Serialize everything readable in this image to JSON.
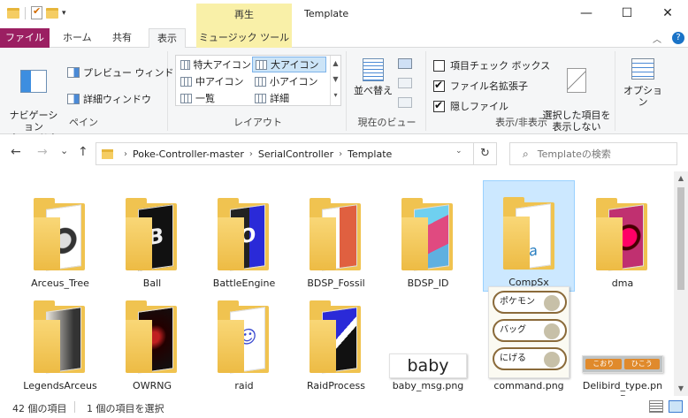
{
  "window": {
    "title": "Template",
    "context_tab_group": "再生",
    "controls": {
      "minimize": "—",
      "maximize": "☐",
      "close": "✕"
    }
  },
  "quick_access": {
    "dropdown": "▾"
  },
  "ribbon_tabs": {
    "file": "ファイル",
    "home": "ホーム",
    "share": "共有",
    "view": "表示",
    "music": "ミュージック ツール",
    "collapse": "︿",
    "help": "?"
  },
  "ribbon": {
    "panes": {
      "nav_pane": "ナビゲーション\nウィンドウ ▾",
      "preview": "プレビュー ウィンドウ",
      "details": "詳細ウィンドウ",
      "label": "ペイン"
    },
    "layout": {
      "items": [
        "特大アイコン",
        "大アイコン",
        "中アイコン",
        "小アイコン",
        "一覧",
        "詳細"
      ],
      "label": "レイアウト",
      "scroll": {
        "up": "▲",
        "down": "▼",
        "more": "▾"
      }
    },
    "current_view": {
      "sort": "並べ替え",
      "label": "現在のビュー"
    },
    "show_hide": {
      "item_checkbox": "項目チェック ボックス",
      "file_ext": "ファイル名拡張子",
      "hidden": "隠しファイル",
      "hide_selected": "選択した項目を\n表示しない",
      "label": "表示/非表示",
      "states": {
        "item_checkbox": false,
        "file_ext": true,
        "hidden": true
      }
    },
    "options": "オプション"
  },
  "nav": {
    "back": "←",
    "forward": "→",
    "recent": "⌄",
    "up": "↑",
    "refresh": "↻",
    "dropdown": "⌄"
  },
  "address": {
    "crumbs": [
      "Poke-Controller-master",
      "SerialController",
      "Template"
    ],
    "separator": "›"
  },
  "search": {
    "placeholder": "Templateの検索",
    "icon": "⌕"
  },
  "items": [
    {
      "name": "Arceus_Tree"
    },
    {
      "name": "Ball"
    },
    {
      "name": "BattleEngine"
    },
    {
      "name": "BDSP_Fossil"
    },
    {
      "name": "BDSP_ID"
    },
    {
      "name": "CompSx",
      "selected": true
    },
    {
      "name": "dma"
    },
    {
      "name": "LegendsArceus"
    },
    {
      "name": "OWRNG"
    },
    {
      "name": "raid"
    },
    {
      "name": "RaidProcess"
    },
    {
      "name": "baby_msg.png",
      "thumb_text": "baby"
    },
    {
      "name": "command.png",
      "pills": [
        "ポケモン",
        "バッグ",
        "にげる"
      ]
    },
    {
      "name": "Delibird_type.png",
      "tags": [
        "こおり",
        "ひこう"
      ]
    }
  ],
  "scrollbar": {
    "up": "▲",
    "down": "▼"
  },
  "status": {
    "count": "42 個の項目",
    "selection": "1 個の項目を選択"
  }
}
